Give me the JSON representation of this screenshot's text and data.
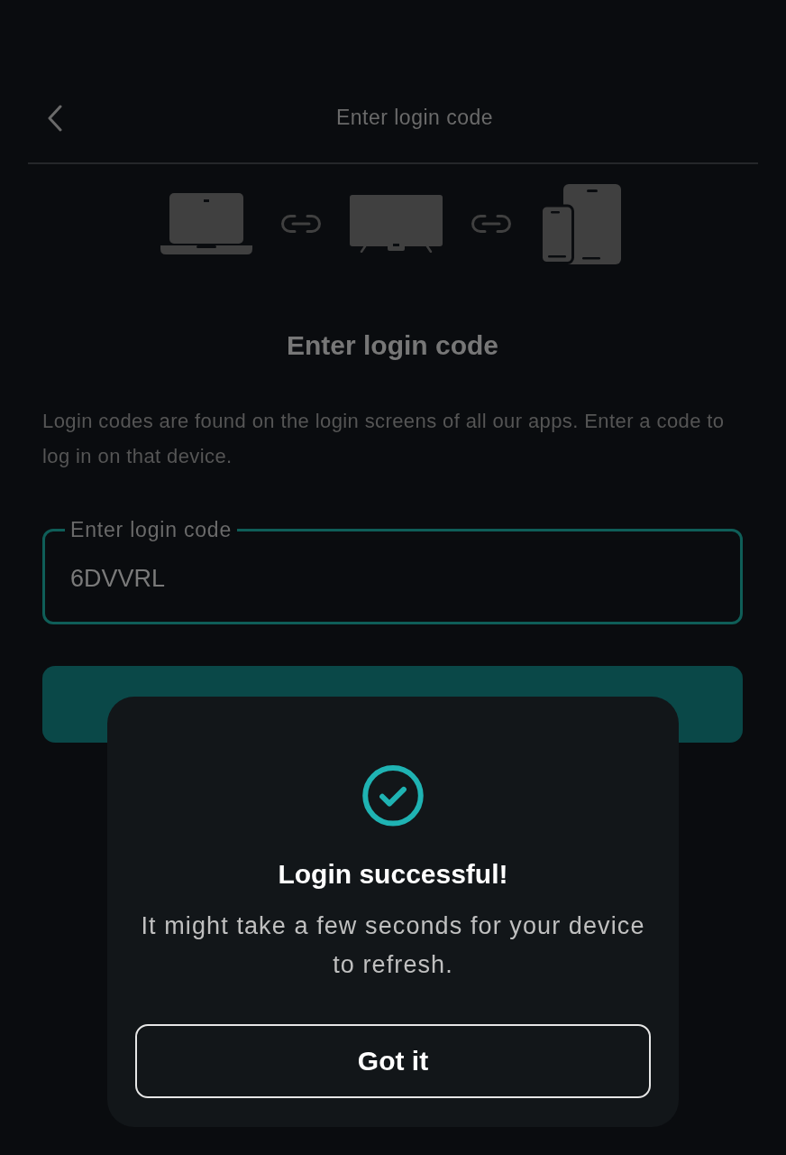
{
  "header": {
    "title": "Enter login code"
  },
  "heading": "Enter login code",
  "description": "Login codes are found on the login screens of all our apps. Enter a code to log in on that device.",
  "code_field": {
    "label": "Enter login code",
    "value": "6DVVRL",
    "focused": true
  },
  "dialog": {
    "title": "Login successful!",
    "message": "It might take a few seconds for your device to refresh.",
    "button": "Got it"
  }
}
